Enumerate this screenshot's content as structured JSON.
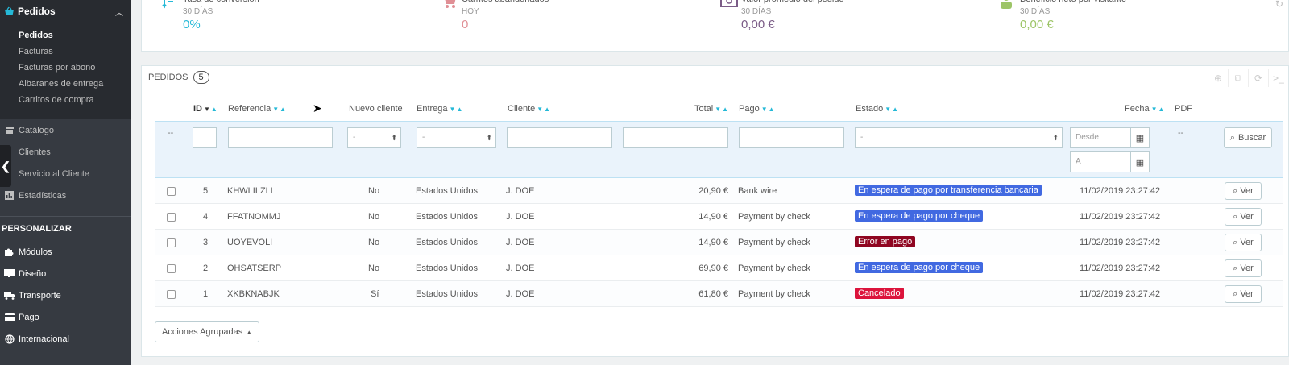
{
  "sidebar": {
    "head": {
      "label": "Pedidos",
      "icon": "basket-icon"
    },
    "sub_items": [
      {
        "label": "Pedidos",
        "active": true
      },
      {
        "label": "Facturas",
        "active": false
      },
      {
        "label": "Facturas por abono",
        "active": false
      },
      {
        "label": "Albaranes de entrega",
        "active": false
      },
      {
        "label": "Carritos de compra",
        "active": false
      }
    ],
    "items": [
      {
        "label": "Catálogo",
        "icon": "store-icon"
      },
      {
        "label": "Clientes",
        "icon": "user-icon"
      },
      {
        "label": "Servicio al Cliente",
        "icon": "chat-icon"
      },
      {
        "label": "Estadísticas",
        "icon": "bar-chart-icon"
      }
    ],
    "section_title": "PERSONALIZAR",
    "items2": [
      {
        "label": "Módulos",
        "icon": "puzzle-icon"
      },
      {
        "label": "Diseño",
        "icon": "monitor-icon"
      },
      {
        "label": "Transporte",
        "icon": "truck-icon"
      },
      {
        "label": "Pago",
        "icon": "credit-card-icon"
      },
      {
        "label": "Internacional",
        "icon": "globe-icon"
      }
    ]
  },
  "kpis": [
    {
      "title": "Tasa de conversión",
      "period": "30 DÍAS",
      "value": "0%",
      "color": "#25b9d7"
    },
    {
      "title": "Carritos abandonados",
      "period": "HOY",
      "value": "0",
      "color": "#e08f95"
    },
    {
      "title": "Valor promedio del pedido",
      "period": "30 DÍAS",
      "value": "0,00 €",
      "color": "#7b5c87"
    },
    {
      "title": "Beneficio neto por visitante",
      "period": "30 DÍAS",
      "value": "0,00 €",
      "color": "#9dc567"
    }
  ],
  "panel": {
    "title": "Pedidos",
    "count": "5",
    "columns": {
      "id": "ID",
      "reference": "Referencia",
      "new_customer": "Nuevo cliente",
      "delivery": "Entrega",
      "customer": "Cliente",
      "total": "Total",
      "payment": "Pago",
      "status": "Estado",
      "date": "Fecha",
      "pdf": "PDF"
    },
    "filters": {
      "dash": "--",
      "select_placeholder": "-",
      "date_from": "Desde",
      "date_to": "A",
      "pdf_dash": "--",
      "search_label": "Buscar"
    },
    "rows": [
      {
        "id": "5",
        "reference": "KHWLILZLL",
        "new_customer": "No",
        "delivery": "Estados Unidos",
        "customer": "J. DOE",
        "total": "20,90 €",
        "payment": "Bank wire",
        "status": "En espera de pago por transferencia bancaria",
        "status_color": "#4169e1",
        "date": "11/02/2019 23:27:42",
        "view_label": "Ver"
      },
      {
        "id": "4",
        "reference": "FFATNOMMJ",
        "new_customer": "No",
        "delivery": "Estados Unidos",
        "customer": "J. DOE",
        "total": "14,90 €",
        "payment": "Payment by check",
        "status": "En espera de pago por cheque",
        "status_color": "#4169e1",
        "date": "11/02/2019 23:27:42",
        "view_label": "Ver"
      },
      {
        "id": "3",
        "reference": "UOYEVOLI",
        "new_customer": "No",
        "delivery": "Estados Unidos",
        "customer": "J. DOE",
        "total": "14,90 €",
        "payment": "Payment by check",
        "status": "Error en pago",
        "status_color": "#8f0621",
        "date": "11/02/2019 23:27:42",
        "view_label": "Ver"
      },
      {
        "id": "2",
        "reference": "OHSATSERP",
        "new_customer": "No",
        "delivery": "Estados Unidos",
        "customer": "J. DOE",
        "total": "69,90 €",
        "payment": "Payment by check",
        "status": "En espera de pago por cheque",
        "status_color": "#4169e1",
        "date": "11/02/2019 23:27:42",
        "view_label": "Ver"
      },
      {
        "id": "1",
        "reference": "XKBKNABJK",
        "new_customer": "Sí",
        "delivery": "Estados Unidos",
        "customer": "J. DOE",
        "total": "61,80 €",
        "payment": "Payment by check",
        "status": "Cancelado",
        "status_color": "#dc143c",
        "date": "11/02/2019 23:27:42",
        "view_label": "Ver"
      }
    ],
    "bulk_actions_label": "Acciones Agrupadas"
  }
}
